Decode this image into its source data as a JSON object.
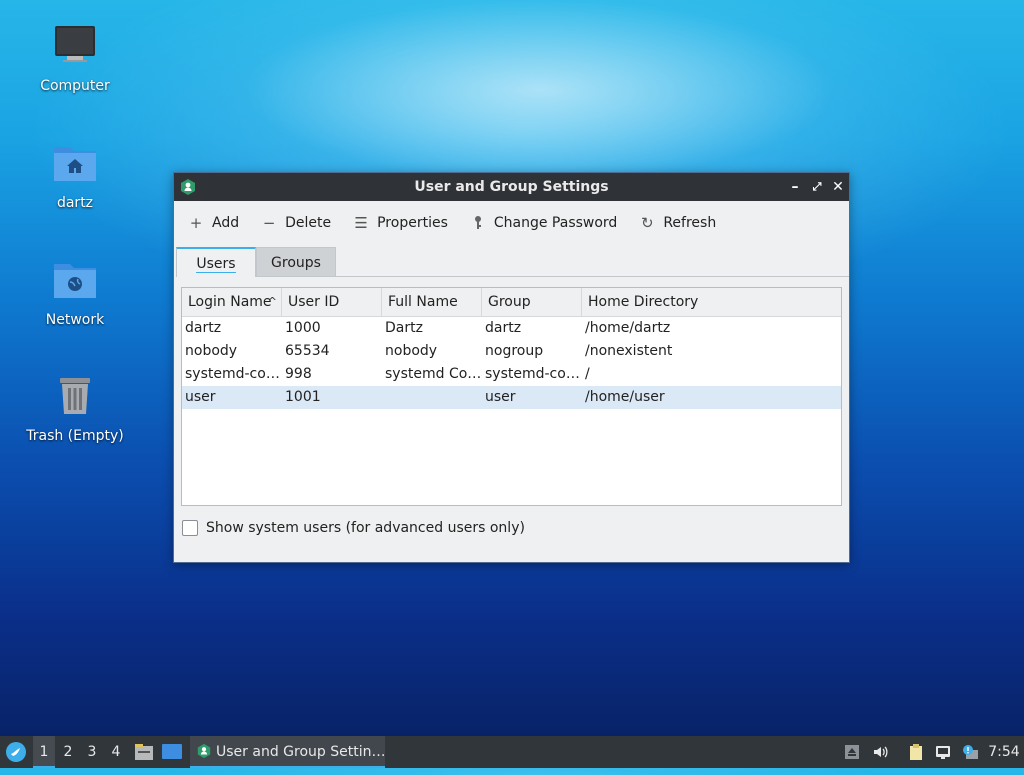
{
  "desktop": {
    "icons": [
      {
        "label": "Computer",
        "icon": "computer-icon"
      },
      {
        "label": "dartz",
        "icon": "home-folder-icon"
      },
      {
        "label": "Network",
        "icon": "network-folder-icon"
      },
      {
        "label": "Trash (Empty)",
        "icon": "trash-icon"
      }
    ]
  },
  "window": {
    "title": "User and Group Settings",
    "toolbar": {
      "add": "Add",
      "delete": "Delete",
      "properties": "Properties",
      "change_password": "Change Password",
      "refresh": "Refresh"
    },
    "tabs": [
      {
        "label": "Users",
        "active": true
      },
      {
        "label": "Groups",
        "active": false
      }
    ],
    "table": {
      "columns": [
        "Login Name",
        "User ID",
        "Full Name",
        "Group",
        "Home Directory"
      ],
      "sort_column": "Login Name",
      "sort_direction": "ascending",
      "rows": [
        {
          "login": "dartz",
          "uid": "1000",
          "full": "Dartz",
          "group": "dartz",
          "home": "/home/dartz"
        },
        {
          "login": "nobody",
          "uid": "65534",
          "full": "nobody",
          "group": "nogroup",
          "home": "/nonexistent"
        },
        {
          "login": "systemd-co…",
          "uid": "998",
          "full": "systemd Co…",
          "group": "systemd-co…",
          "home": "/"
        },
        {
          "login": "user",
          "uid": "1001",
          "full": "",
          "group": "user",
          "home": "/home/user",
          "selected": true
        }
      ]
    },
    "show_system_users": {
      "label": "Show system users (for advanced users only)",
      "checked": false
    }
  },
  "taskbar": {
    "workspaces": [
      "1",
      "2",
      "3",
      "4"
    ],
    "active_workspace": "1",
    "task_title": "User and Group Settin…",
    "clock": "7:54"
  },
  "colors": {
    "accent": "#3daee9",
    "titlebar": "#2f3338",
    "taskbar": "#31363b",
    "selection": "#dbe9f7"
  }
}
